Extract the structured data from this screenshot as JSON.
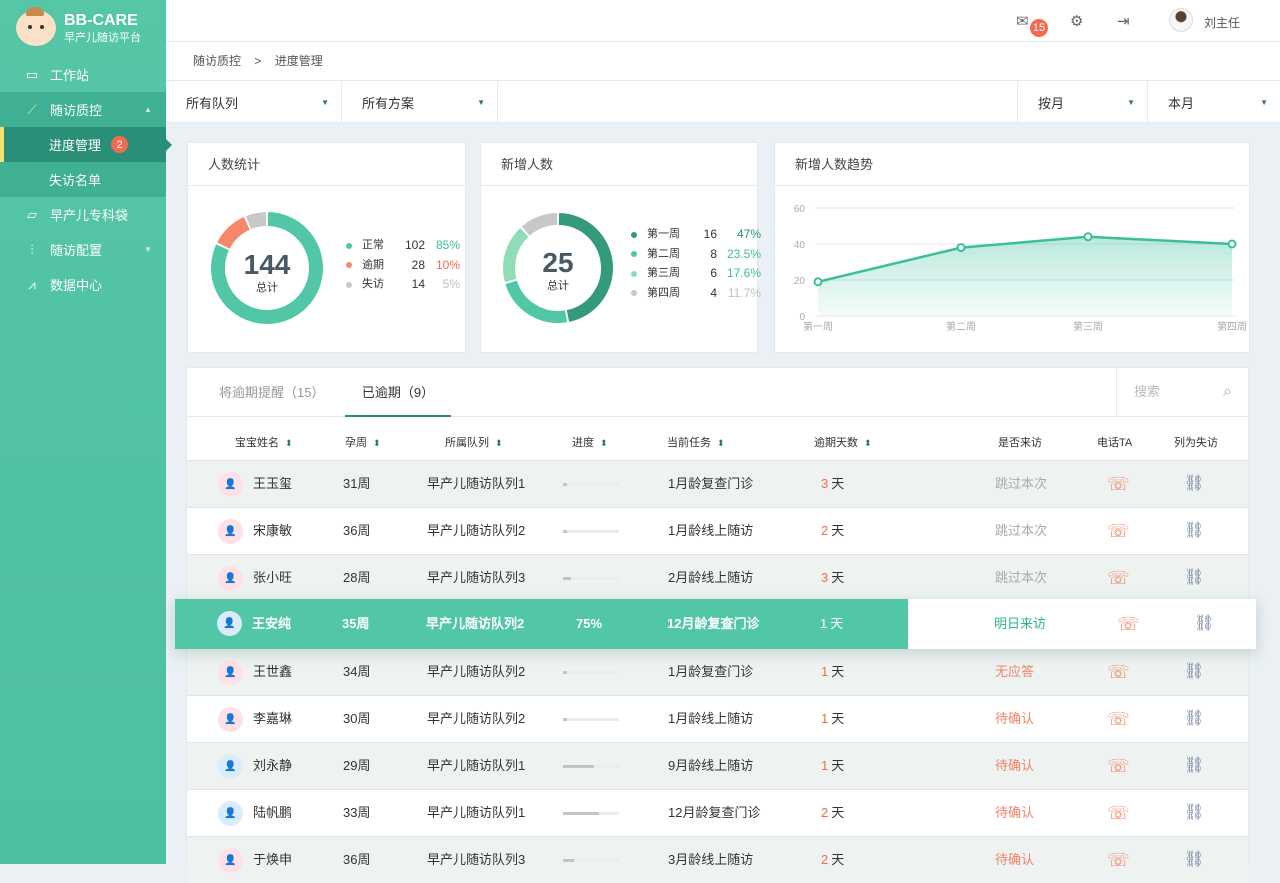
{
  "brand": {
    "name": "BB-CARE",
    "subtitle": "早产儿随访平台"
  },
  "sidebar": {
    "items": [
      {
        "label": "工作站",
        "icon": "monitor-icon"
      },
      {
        "label": "随访质控",
        "icon": "chart-screen-icon",
        "sub": [
          {
            "label": "进度管理",
            "badge": "2"
          },
          {
            "label": "失访名单"
          }
        ]
      },
      {
        "label": "早产儿专科袋",
        "icon": "folder-icon"
      },
      {
        "label": "随访配置",
        "icon": "sliders-icon"
      },
      {
        "label": "数据中心",
        "icon": "line-chart-icon"
      }
    ]
  },
  "header": {
    "mail_count": "15",
    "user": "刘主任"
  },
  "breadcrumb": {
    "parent": "随访质控",
    "sep": ">",
    "current": "进度管理"
  },
  "filters": {
    "queue": "所有队列",
    "plan": "所有方案",
    "period": "按月",
    "range": "本月"
  },
  "stats": {
    "title": "人数统计",
    "total": "144",
    "total_label": "总计",
    "items": [
      {
        "label": "正常",
        "count": "102",
        "pct": "85%",
        "color": "#52c7a8"
      },
      {
        "label": "逾期",
        "count": "28",
        "pct": "10%",
        "color": "#f5876b"
      },
      {
        "label": "失访",
        "count": "14",
        "pct": "5%",
        "color": "#c8c8c8"
      }
    ]
  },
  "newcount": {
    "title": "新增人数",
    "total": "25",
    "total_label": "总计",
    "items": [
      {
        "label": "第一周",
        "count": "16",
        "pct": "47%",
        "color": "#35997b"
      },
      {
        "label": "第二周",
        "count": "8",
        "pct": "23.5%",
        "color": "#52c7a8"
      },
      {
        "label": "第三周",
        "count": "6",
        "pct": "17.6%",
        "color": "#8fdcb6"
      },
      {
        "label": "第四周",
        "count": "4",
        "pct": "11.7%",
        "color": "#c8c8c8"
      }
    ]
  },
  "chart_data": {
    "type": "area",
    "title": "新增人数趋势",
    "categories": [
      "第一周",
      "第二周",
      "第三周",
      "第四周"
    ],
    "values": [
      19,
      38,
      44,
      40
    ],
    "yticks": [
      "0",
      "20",
      "40",
      "60"
    ],
    "ylim": [
      0,
      60
    ],
    "grid": true
  },
  "table": {
    "tabs": [
      {
        "label": "将逾期提醒（15）"
      },
      {
        "label": "已逾期（9）"
      }
    ],
    "search_placeholder": "搜索",
    "headers": [
      "宝宝姓名",
      "孕周",
      "所属队列",
      "进度",
      "当前任务",
      "逾期天数",
      "是否来访",
      "电话TA",
      "列为失访"
    ],
    "rows": [
      {
        "name": "王玉玺",
        "sex": "f",
        "week": "31周",
        "queue": "早产儿随访队列1",
        "progress": 8,
        "task": "1月龄复查门诊",
        "days": "3",
        "unit": "天",
        "visit": "跳过本次",
        "vt": "skip"
      },
      {
        "name": "宋康敏",
        "sex": "f",
        "week": "36周",
        "queue": "早产儿随访队列2",
        "progress": 8,
        "task": "1月龄线上随访",
        "days": "2",
        "unit": "天",
        "visit": "跳过本次",
        "vt": "skip"
      },
      {
        "name": "张小旺",
        "sex": "f",
        "week": "28周",
        "queue": "早产儿随访队列3",
        "progress": 15,
        "task": "2月龄线上随访",
        "days": "3",
        "unit": "天",
        "visit": "跳过本次",
        "vt": "skip"
      },
      {
        "name": "王安纯",
        "sex": "m",
        "week": "35周",
        "queue": "早产儿随访队列2",
        "progress": 75,
        "progress_label": "75%",
        "task": "12月龄复查门诊",
        "days": "1",
        "unit": "天",
        "visit": "明日来访",
        "vt": "ok",
        "highlight": true
      },
      {
        "name": "王世鑫",
        "sex": "f",
        "week": "34周",
        "queue": "早产儿随访队列2",
        "progress": 8,
        "task": "1月龄复查门诊",
        "days": "1",
        "unit": "天",
        "visit": "无应答",
        "vt": "warn"
      },
      {
        "name": "李嘉琳",
        "sex": "f",
        "week": "30周",
        "queue": "早产儿随访队列2",
        "progress": 8,
        "task": "1月龄线上随访",
        "days": "1",
        "unit": "天",
        "visit": "待确认",
        "vt": "warn"
      },
      {
        "name": "刘永静",
        "sex": "m",
        "week": "29周",
        "queue": "早产儿随访队列1",
        "progress": 55,
        "task": "9月龄线上随访",
        "days": "1",
        "unit": "天",
        "visit": "待确认",
        "vt": "warn"
      },
      {
        "name": "陆帆鹏",
        "sex": "m",
        "week": "33周",
        "queue": "早产儿随访队列1",
        "progress": 65,
        "task": "12月龄复查门诊",
        "days": "2",
        "unit": "天",
        "visit": "待确认",
        "vt": "warn"
      },
      {
        "name": "于焕申",
        "sex": "f",
        "week": "36周",
        "queue": "早产儿随访队列3",
        "progress": 20,
        "task": "3月龄线上随访",
        "days": "2",
        "unit": "天",
        "visit": "待确认",
        "vt": "warn"
      }
    ]
  }
}
